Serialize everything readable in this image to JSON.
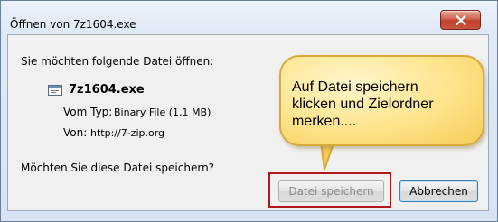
{
  "window": {
    "title": "Öffnen von 7z1604.exe",
    "close_label": "x"
  },
  "dialog": {
    "prompt": "Sie möchten folgende Datei öffnen:",
    "file_icon": "executable-file-icon",
    "filename": "7z1604.exe",
    "type_label": "Vom Typ:",
    "type_value": "Binary File (1,1 MB)",
    "source_label": "Von:",
    "source_value": "http://7-zip.org",
    "question": "Möchten Sie diese Datei speichern?"
  },
  "buttons": {
    "save_label": "Datei speichern",
    "cancel_label": "Abbrechen"
  },
  "callout": {
    "text": "Auf Datei speichern\nklicken und Zielordner\nmerken...."
  },
  "colors": {
    "highlight_frame": "#b0191a",
    "callout_fill": "#ffe38a",
    "callout_border": "#d6aa3b",
    "close_button": "#c8553f"
  }
}
